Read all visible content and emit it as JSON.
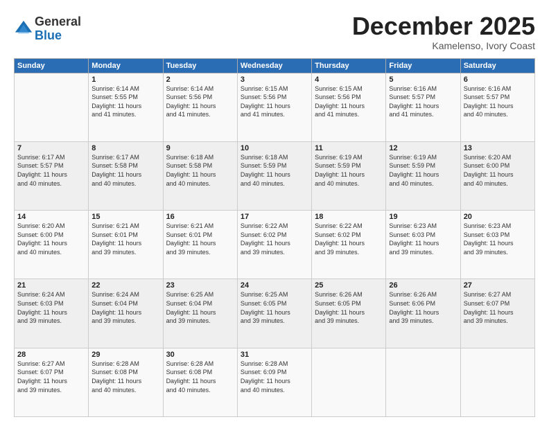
{
  "header": {
    "logo": {
      "general": "General",
      "blue": "Blue"
    },
    "month": "December 2025",
    "location": "Kamelenso, Ivory Coast"
  },
  "weekdays": [
    "Sunday",
    "Monday",
    "Tuesday",
    "Wednesday",
    "Thursday",
    "Friday",
    "Saturday"
  ],
  "weeks": [
    [
      {
        "day": "",
        "info": ""
      },
      {
        "day": "1",
        "info": "Sunrise: 6:14 AM\nSunset: 5:55 PM\nDaylight: 11 hours\nand 41 minutes."
      },
      {
        "day": "2",
        "info": "Sunrise: 6:14 AM\nSunset: 5:56 PM\nDaylight: 11 hours\nand 41 minutes."
      },
      {
        "day": "3",
        "info": "Sunrise: 6:15 AM\nSunset: 5:56 PM\nDaylight: 11 hours\nand 41 minutes."
      },
      {
        "day": "4",
        "info": "Sunrise: 6:15 AM\nSunset: 5:56 PM\nDaylight: 11 hours\nand 41 minutes."
      },
      {
        "day": "5",
        "info": "Sunrise: 6:16 AM\nSunset: 5:57 PM\nDaylight: 11 hours\nand 41 minutes."
      },
      {
        "day": "6",
        "info": "Sunrise: 6:16 AM\nSunset: 5:57 PM\nDaylight: 11 hours\nand 40 minutes."
      }
    ],
    [
      {
        "day": "7",
        "info": "Sunrise: 6:17 AM\nSunset: 5:57 PM\nDaylight: 11 hours\nand 40 minutes."
      },
      {
        "day": "8",
        "info": "Sunrise: 6:17 AM\nSunset: 5:58 PM\nDaylight: 11 hours\nand 40 minutes."
      },
      {
        "day": "9",
        "info": "Sunrise: 6:18 AM\nSunset: 5:58 PM\nDaylight: 11 hours\nand 40 minutes."
      },
      {
        "day": "10",
        "info": "Sunrise: 6:18 AM\nSunset: 5:59 PM\nDaylight: 11 hours\nand 40 minutes."
      },
      {
        "day": "11",
        "info": "Sunrise: 6:19 AM\nSunset: 5:59 PM\nDaylight: 11 hours\nand 40 minutes."
      },
      {
        "day": "12",
        "info": "Sunrise: 6:19 AM\nSunset: 5:59 PM\nDaylight: 11 hours\nand 40 minutes."
      },
      {
        "day": "13",
        "info": "Sunrise: 6:20 AM\nSunset: 6:00 PM\nDaylight: 11 hours\nand 40 minutes."
      }
    ],
    [
      {
        "day": "14",
        "info": "Sunrise: 6:20 AM\nSunset: 6:00 PM\nDaylight: 11 hours\nand 40 minutes."
      },
      {
        "day": "15",
        "info": "Sunrise: 6:21 AM\nSunset: 6:01 PM\nDaylight: 11 hours\nand 39 minutes."
      },
      {
        "day": "16",
        "info": "Sunrise: 6:21 AM\nSunset: 6:01 PM\nDaylight: 11 hours\nand 39 minutes."
      },
      {
        "day": "17",
        "info": "Sunrise: 6:22 AM\nSunset: 6:02 PM\nDaylight: 11 hours\nand 39 minutes."
      },
      {
        "day": "18",
        "info": "Sunrise: 6:22 AM\nSunset: 6:02 PM\nDaylight: 11 hours\nand 39 minutes."
      },
      {
        "day": "19",
        "info": "Sunrise: 6:23 AM\nSunset: 6:03 PM\nDaylight: 11 hours\nand 39 minutes."
      },
      {
        "day": "20",
        "info": "Sunrise: 6:23 AM\nSunset: 6:03 PM\nDaylight: 11 hours\nand 39 minutes."
      }
    ],
    [
      {
        "day": "21",
        "info": "Sunrise: 6:24 AM\nSunset: 6:03 PM\nDaylight: 11 hours\nand 39 minutes."
      },
      {
        "day": "22",
        "info": "Sunrise: 6:24 AM\nSunset: 6:04 PM\nDaylight: 11 hours\nand 39 minutes."
      },
      {
        "day": "23",
        "info": "Sunrise: 6:25 AM\nSunset: 6:04 PM\nDaylight: 11 hours\nand 39 minutes."
      },
      {
        "day": "24",
        "info": "Sunrise: 6:25 AM\nSunset: 6:05 PM\nDaylight: 11 hours\nand 39 minutes."
      },
      {
        "day": "25",
        "info": "Sunrise: 6:26 AM\nSunset: 6:05 PM\nDaylight: 11 hours\nand 39 minutes."
      },
      {
        "day": "26",
        "info": "Sunrise: 6:26 AM\nSunset: 6:06 PM\nDaylight: 11 hours\nand 39 minutes."
      },
      {
        "day": "27",
        "info": "Sunrise: 6:27 AM\nSunset: 6:07 PM\nDaylight: 11 hours\nand 39 minutes."
      }
    ],
    [
      {
        "day": "28",
        "info": "Sunrise: 6:27 AM\nSunset: 6:07 PM\nDaylight: 11 hours\nand 39 minutes."
      },
      {
        "day": "29",
        "info": "Sunrise: 6:28 AM\nSunset: 6:08 PM\nDaylight: 11 hours\nand 40 minutes."
      },
      {
        "day": "30",
        "info": "Sunrise: 6:28 AM\nSunset: 6:08 PM\nDaylight: 11 hours\nand 40 minutes."
      },
      {
        "day": "31",
        "info": "Sunrise: 6:28 AM\nSunset: 6:09 PM\nDaylight: 11 hours\nand 40 minutes."
      },
      {
        "day": "",
        "info": ""
      },
      {
        "day": "",
        "info": ""
      },
      {
        "day": "",
        "info": ""
      }
    ]
  ]
}
